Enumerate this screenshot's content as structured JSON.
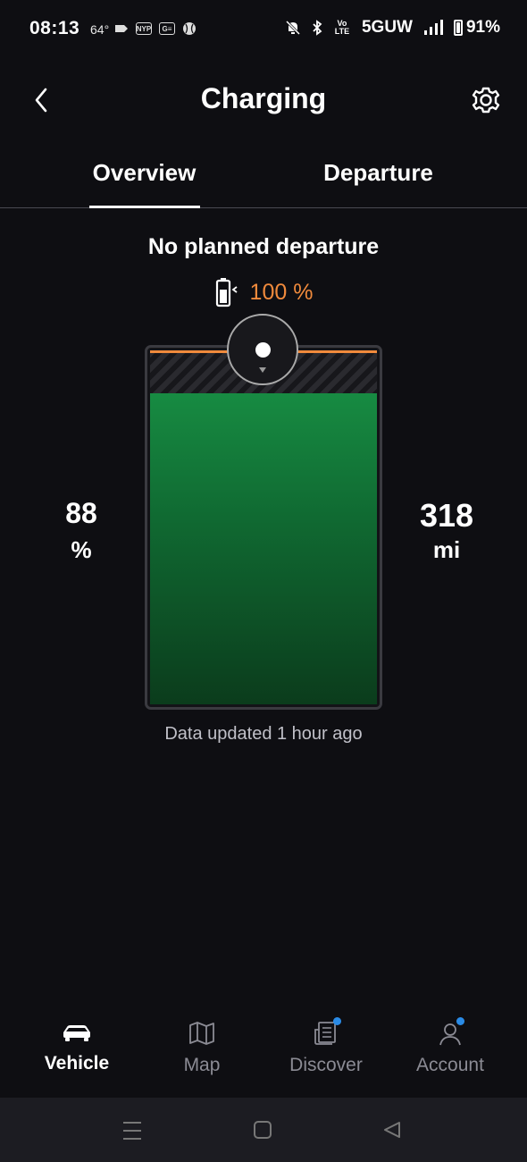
{
  "status_bar": {
    "time": "08:13",
    "temperature": "64°",
    "app_icons": [
      "NYP",
      "G≡"
    ],
    "network": "5GUW",
    "volte": "Vo LTE",
    "battery": "91%"
  },
  "header": {
    "title": "Charging"
  },
  "tabs": [
    {
      "label": "Overview",
      "active": true
    },
    {
      "label": "Departure",
      "active": false
    }
  ],
  "main": {
    "departure_status": "No planned departure",
    "charge_target": "100 %",
    "state_of_charge": {
      "value": "88",
      "unit": "%"
    },
    "range": {
      "value": "318",
      "unit": "mi"
    },
    "battery_level_fraction": 0.88,
    "charge_target_fraction": 1.0,
    "updated": "Data updated 1 hour ago"
  },
  "nav": [
    {
      "label": "Vehicle",
      "icon": "car-icon",
      "active": true,
      "badge": false
    },
    {
      "label": "Map",
      "icon": "map-icon",
      "active": false,
      "badge": false
    },
    {
      "label": "Discover",
      "icon": "news-icon",
      "active": false,
      "badge": true
    },
    {
      "label": "Account",
      "icon": "user-icon",
      "active": false,
      "badge": true
    }
  ],
  "colors": {
    "accent_orange": "#f08a3c",
    "battery_green": "#178b42",
    "badge_blue": "#2a8be6",
    "background": "#0e0e12"
  }
}
